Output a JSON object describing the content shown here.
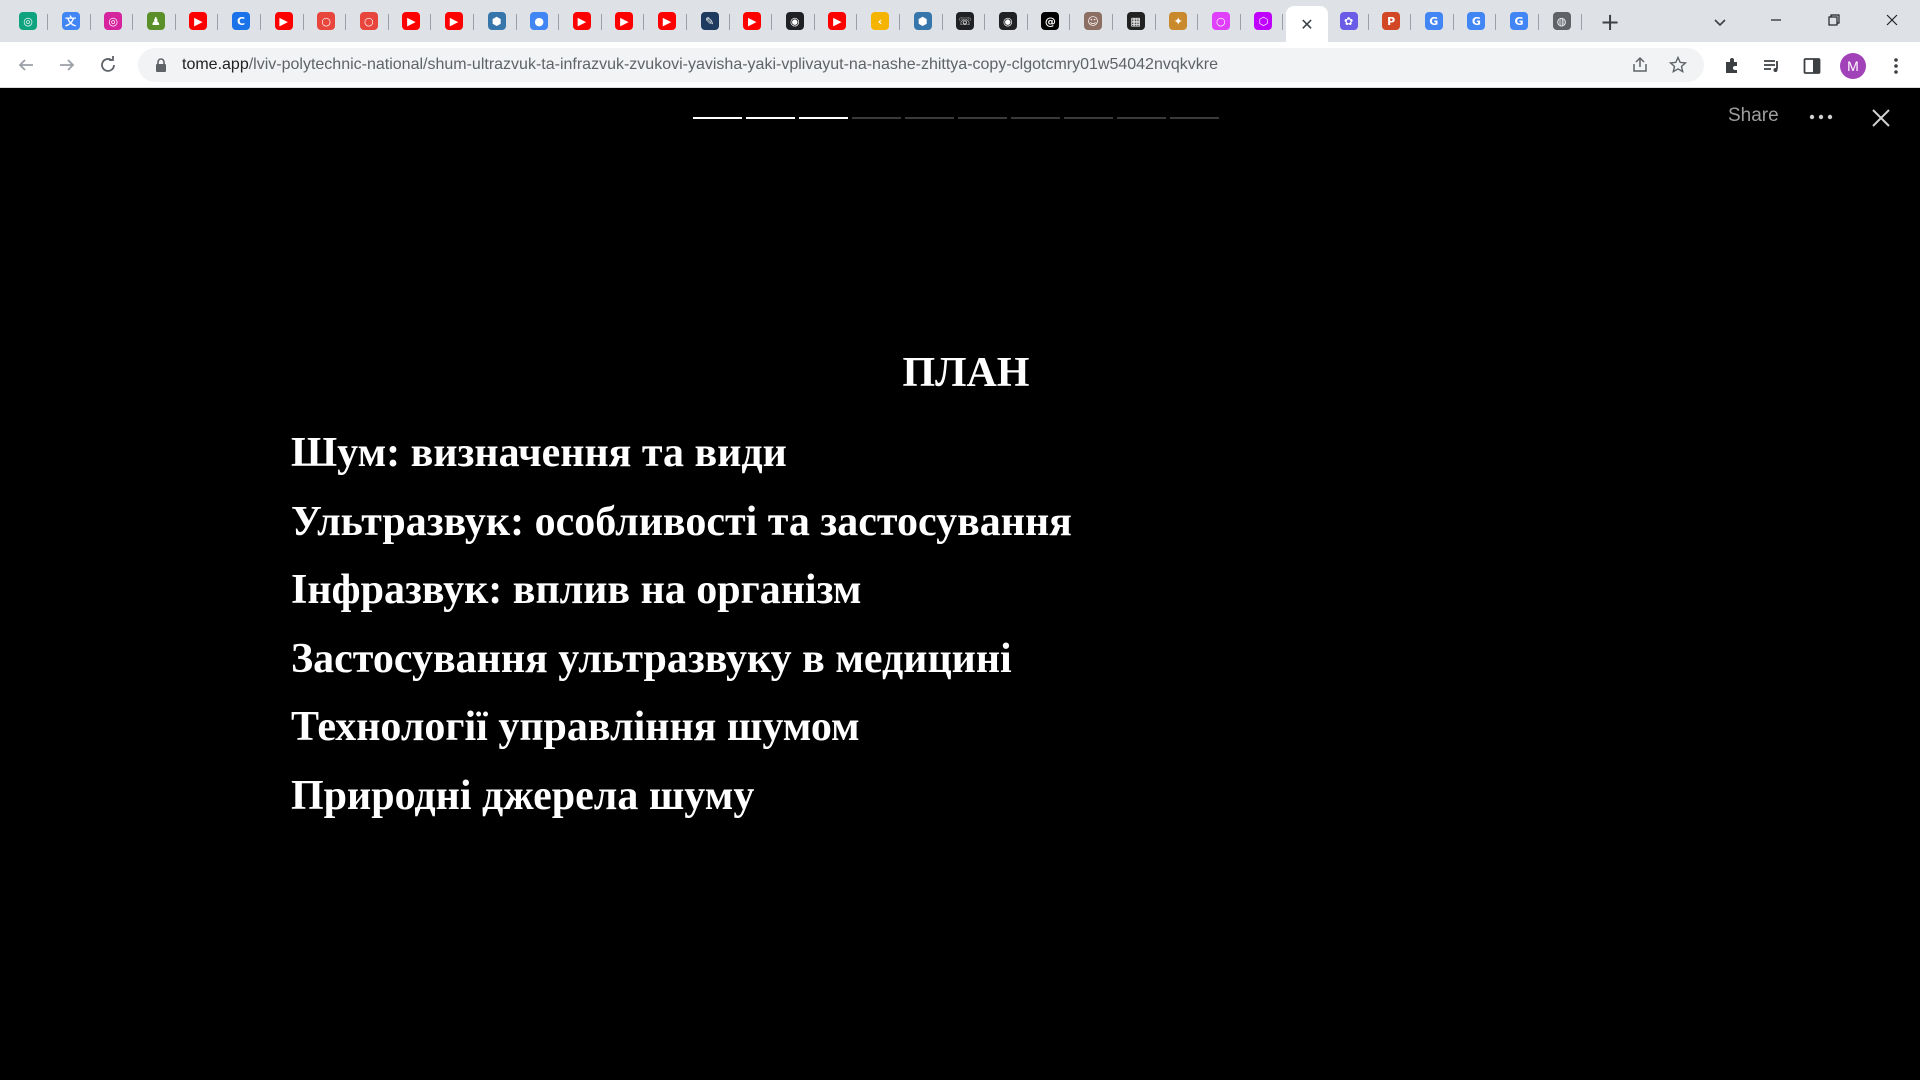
{
  "browser": {
    "tabs": [
      {
        "icon": "chatgpt-icon",
        "color": "#10a37f",
        "glyph": "◎"
      },
      {
        "icon": "translate-icon",
        "color": "#4285f4",
        "glyph": "文"
      },
      {
        "icon": "instagram-icon",
        "color": "#d6249f",
        "glyph": "◎"
      },
      {
        "icon": "app-icon",
        "color": "#5a8f29",
        "glyph": "♟"
      },
      {
        "icon": "youtube-icon",
        "color": "#ff0000",
        "glyph": "▶"
      },
      {
        "icon": "c-icon",
        "color": "#1a73e8",
        "glyph": "C"
      },
      {
        "icon": "youtube-icon",
        "color": "#ff0000",
        "glyph": "▶"
      },
      {
        "icon": "ring-icon",
        "color": "#e8453c",
        "glyph": "○"
      },
      {
        "icon": "ring-icon",
        "color": "#e8453c",
        "glyph": "○"
      },
      {
        "icon": "youtube-icon",
        "color": "#ff0000",
        "glyph": "▶"
      },
      {
        "icon": "youtube-icon",
        "color": "#ff0000",
        "glyph": "▶"
      },
      {
        "icon": "python-icon",
        "color": "#3776ab",
        "glyph": "⬢"
      },
      {
        "icon": "pin-icon",
        "color": "#4285f4",
        "glyph": "●"
      },
      {
        "icon": "youtube-icon",
        "color": "#ff0000",
        "glyph": "▶"
      },
      {
        "icon": "youtube-icon",
        "color": "#ff0000",
        "glyph": "▶"
      },
      {
        "icon": "youtube-icon",
        "color": "#ff0000",
        "glyph": "▶"
      },
      {
        "icon": "docs-icon",
        "color": "#1e3a5f",
        "glyph": "✎"
      },
      {
        "icon": "youtube-icon",
        "color": "#ff0000",
        "glyph": "▶"
      },
      {
        "icon": "globe-icon",
        "color": "#202124",
        "glyph": "◉"
      },
      {
        "icon": "youtube-icon",
        "color": "#ff0000",
        "glyph": "▶"
      },
      {
        "icon": "bracket-icon",
        "color": "#f4b400",
        "glyph": "‹"
      },
      {
        "icon": "python-icon",
        "color": "#3776ab",
        "glyph": "⬢"
      },
      {
        "icon": "phone-icon",
        "color": "#202124",
        "glyph": "☏"
      },
      {
        "icon": "globe-icon",
        "color": "#202124",
        "glyph": "◉"
      },
      {
        "icon": "threads-icon",
        "color": "#000000",
        "glyph": "@"
      },
      {
        "icon": "avatar-icon",
        "color": "#8d6e63",
        "glyph": "☺"
      },
      {
        "icon": "terminal-icon",
        "color": "#222222",
        "glyph": "▦"
      },
      {
        "icon": "pieces-icon",
        "color": "#c98a2e",
        "glyph": "✦"
      },
      {
        "icon": "circle-icon",
        "color": "#e040fb",
        "glyph": "○"
      },
      {
        "icon": "hexagon-icon",
        "color": "#c000ff",
        "glyph": "⬡"
      }
    ],
    "active_tab_close": "✕",
    "after_tabs": [
      {
        "icon": "copilot-icon",
        "color": "#6b5ce7",
        "glyph": "✿"
      },
      {
        "icon": "powerpoint-icon",
        "color": "#d24726",
        "glyph": "P"
      },
      {
        "icon": "google-icon",
        "color": "#4285f4",
        "glyph": "G"
      },
      {
        "icon": "google-icon",
        "color": "#4285f4",
        "glyph": "G"
      },
      {
        "icon": "google-icon",
        "color": "#4285f4",
        "glyph": "G"
      },
      {
        "icon": "chrome-icon",
        "color": "#5f6368",
        "glyph": "◍"
      }
    ],
    "new_tab": "+",
    "url_host": "tome.app",
    "url_path": "/lviv-polytechnic-national/shum-ultrazvuk-ta-infrazvuk-zvukovi-yavisha-yaki-vplivayut-na-nashe-zhittya-copy-clgotcmry01w54042nvqkvkre",
    "profile_initial": "M"
  },
  "viewer": {
    "progress_total": 10,
    "progress_done": 3,
    "share_label": "Share"
  },
  "slide": {
    "title": "ПЛАН",
    "items": [
      "Шум: визначення та види",
      "Ультразвук: особливості та застосування",
      "Інфразвук: вплив на організм",
      "Застосування ультразвуку в медицині",
      "Технології управління шумом",
      "Природні джерела шуму"
    ]
  }
}
